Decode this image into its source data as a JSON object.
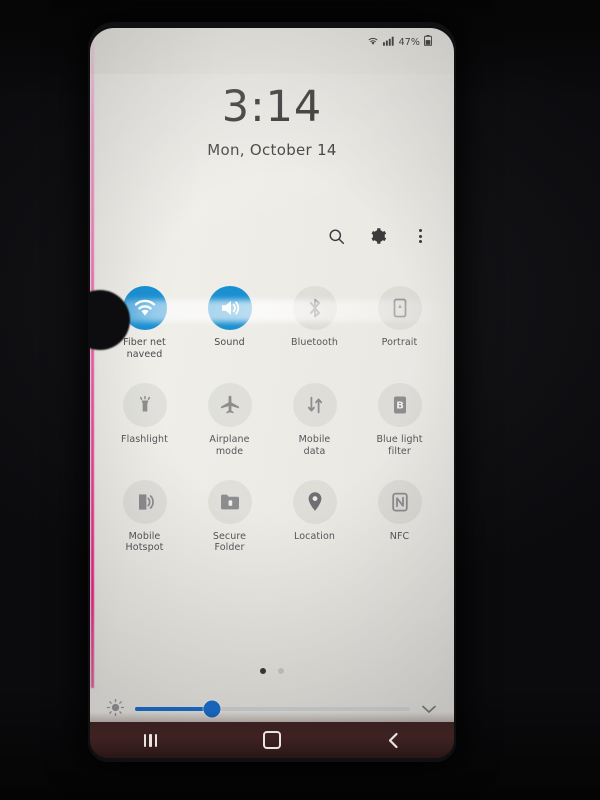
{
  "status_bar": {
    "wifi_icon": "wifi-icon",
    "signal_icon": "cellular-signal-icon",
    "battery_percent": "47%",
    "battery_icon": "battery-icon"
  },
  "lock_header": {
    "time": "3:14",
    "date": "Mon, October 14"
  },
  "header_actions": [
    {
      "name": "search-icon",
      "label": "Search"
    },
    {
      "name": "settings-gear-icon",
      "label": "Settings"
    },
    {
      "name": "more-options-icon",
      "label": "More options"
    }
  ],
  "quick_settings": {
    "tiles": [
      {
        "label": "Fiber net\nnaveed",
        "label_line1": "Fiber net",
        "label_line2": "naveed",
        "icon": "wifi-icon",
        "state": "on"
      },
      {
        "label": "Sound",
        "label_line1": "Sound",
        "label_line2": "",
        "icon": "sound-volume-icon",
        "state": "on"
      },
      {
        "label": "Bluetooth",
        "label_line1": "Bluetooth",
        "label_line2": "",
        "icon": "bluetooth-icon",
        "state": "off"
      },
      {
        "label": "Portrait",
        "label_line1": "Portrait",
        "label_line2": "",
        "icon": "screen-rotation-portrait-icon",
        "state": "off"
      },
      {
        "label": "Flashlight",
        "label_line1": "Flashlight",
        "label_line2": "",
        "icon": "flashlight-icon",
        "state": "off"
      },
      {
        "label": "Airplane mode",
        "label_line1": "Airplane",
        "label_line2": "mode",
        "icon": "airplane-icon",
        "state": "off"
      },
      {
        "label": "Mobile data",
        "label_line1": "Mobile",
        "label_line2": "data",
        "icon": "mobile-data-arrows-icon",
        "state": "off"
      },
      {
        "label": "Blue light filter",
        "label_line1": "Blue light",
        "label_line2": "filter",
        "icon": "blue-light-filter-icon",
        "state": "off"
      },
      {
        "label": "Mobile Hotspot",
        "label_line1": "Mobile",
        "label_line2": "Hotspot",
        "icon": "mobile-hotspot-icon",
        "state": "off"
      },
      {
        "label": "Secure Folder",
        "label_line1": "Secure",
        "label_line2": "Folder",
        "icon": "secure-folder-icon",
        "state": "off"
      },
      {
        "label": "Location",
        "label_line1": "Location",
        "label_line2": "",
        "icon": "location-pin-icon",
        "state": "off"
      },
      {
        "label": "NFC",
        "label_line1": "NFC",
        "label_line2": "",
        "icon": "nfc-icon",
        "state": "off"
      }
    ],
    "page_dots": {
      "count": 2,
      "active_index": 0
    }
  },
  "brightness": {
    "icon": "brightness-sun-icon",
    "value_percent": 28,
    "expand_icon": "chevron-down-icon"
  },
  "nav_bar": {
    "recents": "recents-icon",
    "home": "home-icon",
    "back": "back-icon"
  },
  "colors": {
    "accent_on": "#1a8fd1",
    "slider_blue": "#1a73d4",
    "screen_bg": "#ecebe6",
    "label_gray": "#56565a",
    "navbar_bg": "#3e2222"
  }
}
